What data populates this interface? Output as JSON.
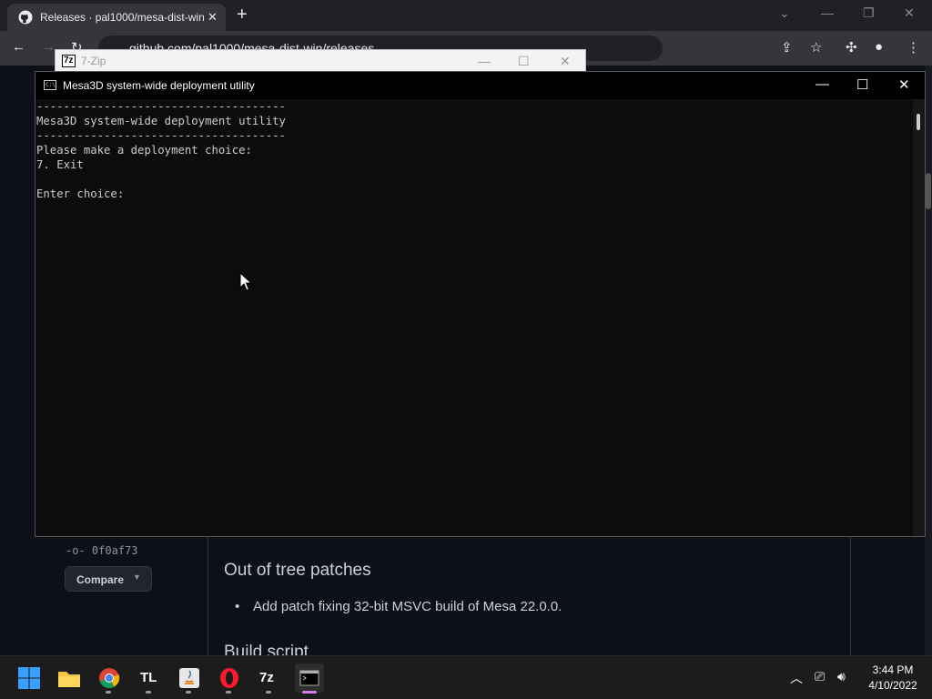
{
  "browser": {
    "tab_title": "Releases · pal1000/mesa-dist-win",
    "tab_close": "✕",
    "new_tab": "+",
    "url": "github.com/pal1000/mesa-dist-win/releases"
  },
  "github": {
    "commit_hash": "0f0af73",
    "compare_label": "Compare",
    "heading_patches": "Out of tree patches",
    "bullet": "Add patch fixing 32-bit MSVC build of Mesa 22.0.0.",
    "heading_build": "Build script"
  },
  "zip_window": {
    "icon_text": "7z",
    "title": "7-Zip"
  },
  "console": {
    "title": "Mesa3D system-wide deployment utility",
    "lines": [
      "-------------------------------------",
      "Mesa3D system-wide deployment utility",
      "-------------------------------------",
      "Please make a deployment choice:",
      "7. Exit",
      "",
      "Enter choice:"
    ]
  },
  "taskbar": {
    "apps": [
      "start",
      "file-explorer",
      "chrome",
      "tl",
      "java",
      "opera",
      "7-zip",
      "terminal"
    ],
    "tl_label": "TL",
    "zip_label": "7z",
    "time": "3:44 PM",
    "date": "4/10/2022"
  },
  "colors": {
    "console_bg": "#0c0c0c",
    "console_text": "#cccccc",
    "github_bg": "#0d1117",
    "taskbar_bg": "#1c1c1c",
    "active_indicator": "#d07ce0"
  }
}
